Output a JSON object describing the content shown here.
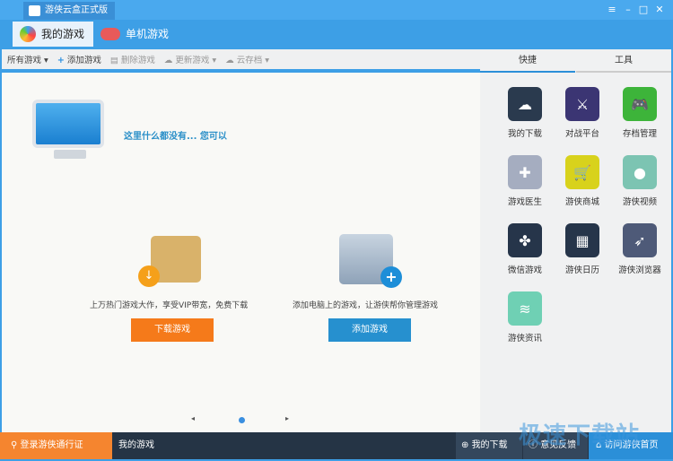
{
  "window": {
    "title": "游侠云盒正式版"
  },
  "tabs": [
    {
      "label": "我的游戏"
    },
    {
      "label": "单机游戏"
    }
  ],
  "toolbar": {
    "all_games": "所有游戏",
    "add": "添加游戏",
    "delete": "删除游戏",
    "update": "更新游戏",
    "cloud": "云存档"
  },
  "main": {
    "empty_text": "这里什么都没有... 您可以",
    "download_desc": "上万热门游戏大作，享受VIP带宽，免费下载",
    "download_btn": "下载游戏",
    "add_desc": "添加电脑上的游戏，让游侠帮你管理游戏",
    "add_btn": "添加游戏"
  },
  "side": {
    "tabs": [
      "快捷",
      "工具"
    ],
    "items": [
      {
        "label": "我的下载",
        "color": "#2a3a4e"
      },
      {
        "label": "对战平台",
        "color": "#3b3573"
      },
      {
        "label": "存档管理",
        "color": "#3db43a"
      },
      {
        "label": "游戏医生",
        "color": "#a5adc0"
      },
      {
        "label": "游侠商城",
        "color": "#d8d21c"
      },
      {
        "label": "游侠视频",
        "color": "#7cc4b2"
      },
      {
        "label": "微信游戏",
        "color": "#26354a"
      },
      {
        "label": "游侠日历",
        "color": "#26354a"
      },
      {
        "label": "游侠浏览器",
        "color": "#4e5a78"
      },
      {
        "label": "游侠资讯",
        "color": "#6fd0b4"
      }
    ]
  },
  "bottom": {
    "login": "登录游侠通行证",
    "my_games": "我的游戏",
    "my_downloads": "我的下载",
    "feedback": "意见反馈",
    "home": "访问游侠首页"
  },
  "watermark": "极速下载站",
  "colors": {
    "accent": "#3d9fe6",
    "orange": "#f57a1a",
    "blue_btn": "#2690cf"
  }
}
